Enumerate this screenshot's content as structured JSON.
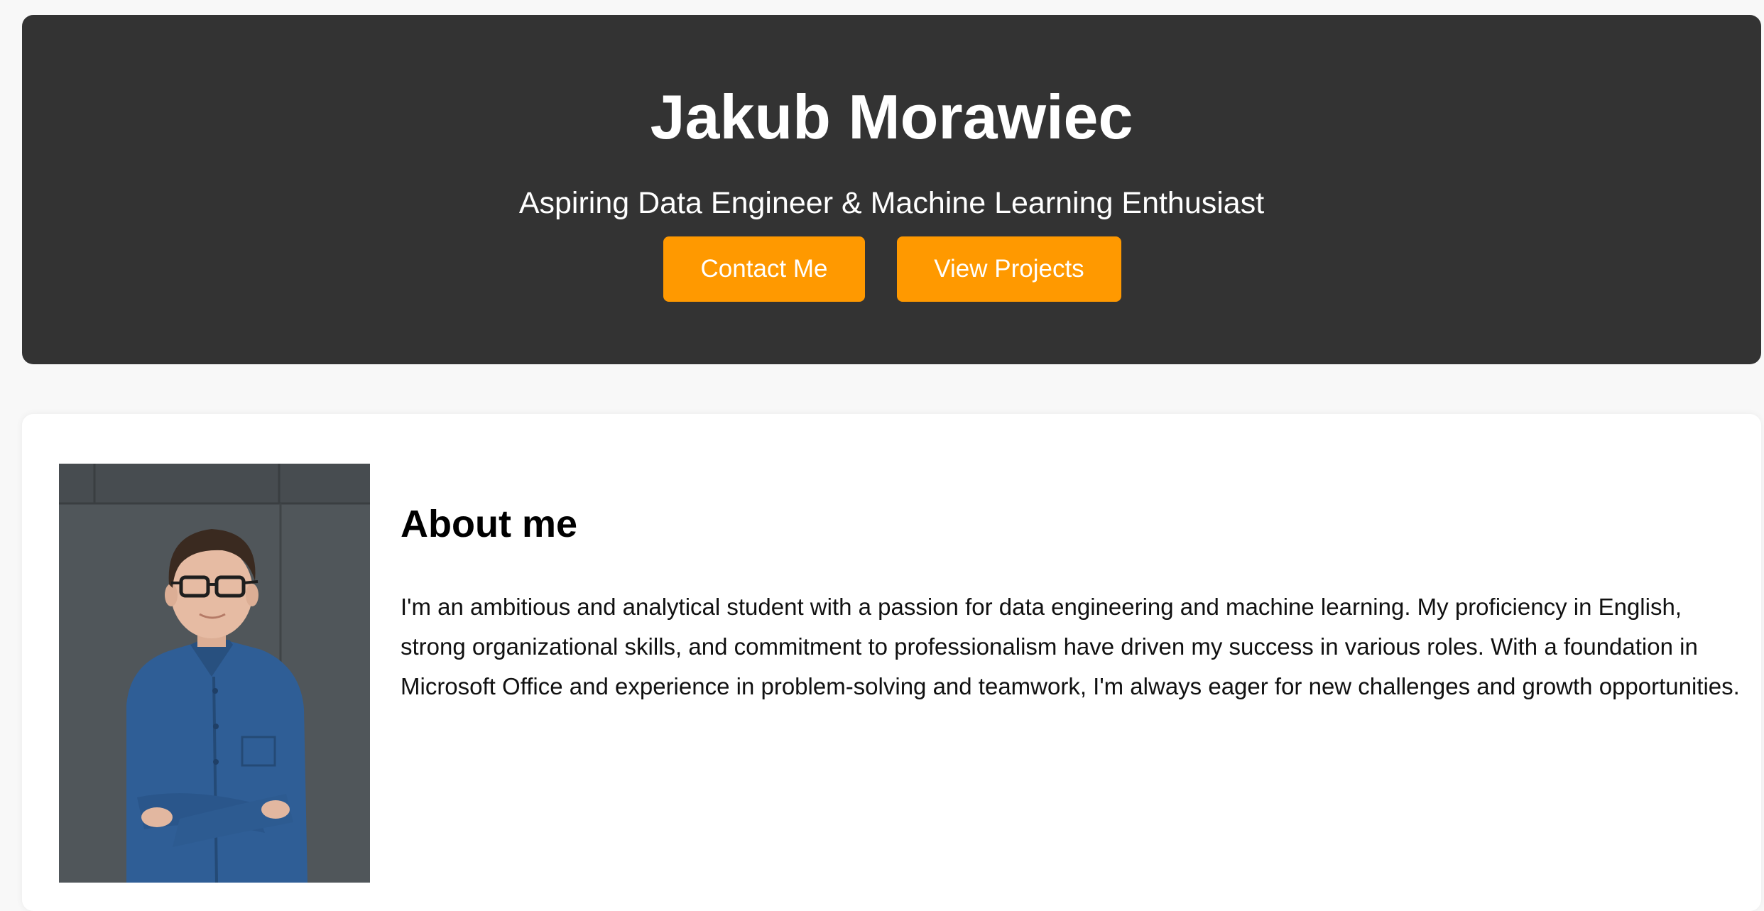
{
  "hero": {
    "name": "Jakub Morawiec",
    "tagline": "Aspiring Data Engineer & Machine Learning Enthusiast",
    "buttons": {
      "contact": "Contact Me",
      "projects": "View Projects"
    }
  },
  "about": {
    "heading": "About me",
    "body": "I'm an ambitious and analytical student with a passion for data engineering and machine learning. My proficiency in English, strong organizational skills, and commitment to professionalism have driven my success in various roles. With a foundation in Microsoft Office and experience in problem-solving and teamwork, I'm always eager for new challenges and growth opportunities."
  },
  "colors": {
    "page_background": "#f8f8f8",
    "hero_background": "#333333",
    "accent": "#ff9900",
    "card_background": "#ffffff"
  }
}
